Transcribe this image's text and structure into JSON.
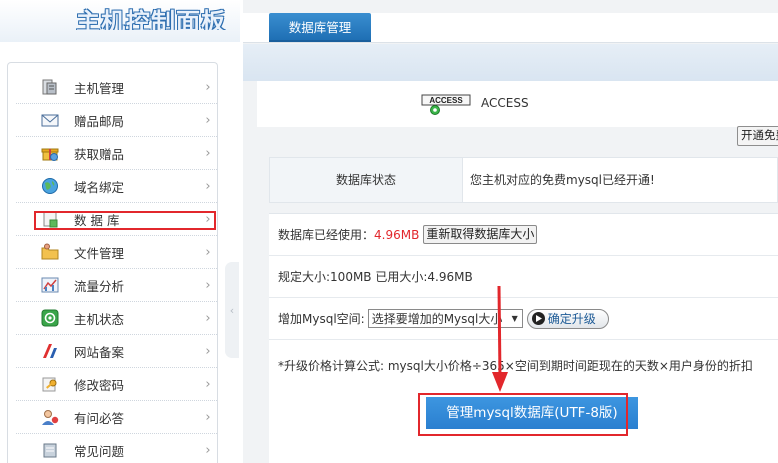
{
  "banner": {
    "title": "主机控制面板"
  },
  "sidebar": {
    "items": [
      {
        "label": "主机管理",
        "icon": "server-icon"
      },
      {
        "label": "赠品邮局",
        "icon": "mail-icon"
      },
      {
        "label": "获取赠品",
        "icon": "gift-icon"
      },
      {
        "label": "域名绑定",
        "icon": "globe-icon"
      },
      {
        "label": "数 据 库",
        "icon": "database-icon"
      },
      {
        "label": "文件管理",
        "icon": "folder-icon"
      },
      {
        "label": "流量分析",
        "icon": "chart-icon"
      },
      {
        "label": "主机状态",
        "icon": "power-icon"
      },
      {
        "label": "网站备案",
        "icon": "record-icon"
      },
      {
        "label": "修改密码",
        "icon": "key-icon"
      },
      {
        "label": "有问必答",
        "icon": "user-help-icon"
      },
      {
        "label": "常见问题",
        "icon": "faq-icon"
      }
    ],
    "arrow": "›",
    "collapse_glyph": "‹"
  },
  "tabs": {
    "active": "数据库管理"
  },
  "access": {
    "logo_text": "ACCESS",
    "label": "ACCESS"
  },
  "open_button": "开通免费",
  "status": {
    "header": "数据库状态",
    "value": "您主机对应的免费mysql已经开通!"
  },
  "info": {
    "used_label": "数据库已经使用：",
    "used_value": "4.96MB",
    "refresh_button": "重新取得数据库大小",
    "size_text": "规定大小:100MB 已用大小:4.96MB",
    "add_label": "增加Mysql空间:",
    "select_value": "选择要增加的Mysql大小",
    "upgrade_button": "确定升级",
    "formula": "*升级价格计算公式: mysql大小价格÷365×空间到期时间距现在的天数×用户身份的折扣"
  },
  "manage_button": "管理mysql数据库(UTF-8版)",
  "colors": {
    "accent": "#2a7fd0",
    "highlight": "#e2272c",
    "used_value": "#e2272c"
  }
}
